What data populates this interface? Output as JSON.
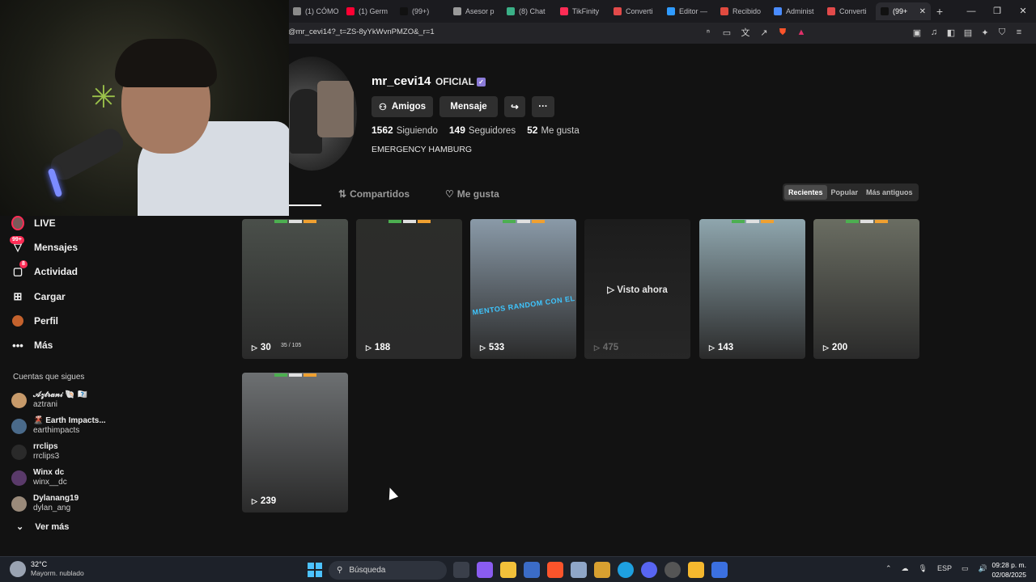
{
  "browser": {
    "tabs": [
      {
        "label": "(1) CÓMO",
        "color": "#8a8a8a"
      },
      {
        "label": "(1) Germ",
        "color": "#ff0033"
      },
      {
        "label": "(99+) ",
        "color": "#111111"
      },
      {
        "label": "Asesor p",
        "color": "#9a9a9a"
      },
      {
        "label": "(8) Chat",
        "color": "#3ab087"
      },
      {
        "label": "TikFinity",
        "color": "#fe2c55"
      },
      {
        "label": "Converti",
        "color": "#e24a4a"
      },
      {
        "label": "Editor —",
        "color": "#2f9bff"
      },
      {
        "label": "Recibido",
        "color": "#e04a3f"
      },
      {
        "label": "Administ",
        "color": "#4a8cff"
      },
      {
        "label": "Converti",
        "color": "#e24a4a"
      },
      {
        "label": "(99+",
        "color": "#111111"
      }
    ],
    "url": "@mr_cevi14?_t=ZS-8yYkWvnPMZO&_r=1"
  },
  "sidebar": {
    "items": [
      {
        "label": "LIVE",
        "icon": "live-avatar-icon"
      },
      {
        "label": "Mensajes",
        "icon": "messages-icon",
        "badge": "99+"
      },
      {
        "label": "Actividad",
        "icon": "activity-icon",
        "badge": "8"
      },
      {
        "label": "Cargar",
        "icon": "upload-icon"
      },
      {
        "label": "Perfil",
        "icon": "profile-icon"
      },
      {
        "label": "Más",
        "icon": "more-icon"
      }
    ],
    "following_title": "Cuentas que sigues",
    "following": [
      {
        "name": "𝒜𝓏𝓉𝓇𝒶𝓃𝒾 🐚 🇽🇽",
        "handle": "aztrani",
        "color": "#c79a6a"
      },
      {
        "name": "🌋 Earth Impacts...",
        "handle": "earthimpacts",
        "color": "#4a6a8a"
      },
      {
        "name": "rrclips",
        "handle": "rrclips3",
        "color": "#2a2a2a"
      },
      {
        "name": "Winx dc",
        "handle": "winx__dc",
        "color": "#5a3a6a"
      },
      {
        "name": "Dylanang19",
        "handle": "dylan_ang",
        "color": "#9a8a7a"
      }
    ],
    "ver_mas": "Ver más"
  },
  "profile": {
    "username": "mr_cevi14",
    "oficial": "OFICIAL",
    "buttons": {
      "amigos": "Amigos",
      "mensaje": "Mensaje"
    },
    "stats": [
      {
        "value": "1562",
        "label": "Siguiendo"
      },
      {
        "value": "149",
        "label": "Seguidores"
      },
      {
        "value": "52",
        "label": "Me gusta"
      }
    ],
    "bio": "EMERGENCY HAMBURG",
    "tabs": {
      "videos": "eos",
      "compartidos": "Compartidos",
      "me_gusta": "Me gusta"
    },
    "sort": [
      "Recientes",
      "Popular",
      "Más antiguos"
    ]
  },
  "videos": [
    {
      "views": "30",
      "bg": "#4a4f4a",
      "inner": "35 / 105"
    },
    {
      "views": "188",
      "bg": "#2c2d2a"
    },
    {
      "views": "533",
      "bg": "#8a9aa8",
      "overlay_text": "MENTOS RANDOM CON EL CEVI"
    },
    {
      "views": "475",
      "bg": "#1e1e1e",
      "watched": "Visto ahora"
    },
    {
      "views": "143",
      "bg": "#8fa6ae"
    },
    {
      "views": "200",
      "bg": "#6a6d62"
    },
    {
      "views": "239",
      "bg": "#6d7072"
    }
  ],
  "taskbar": {
    "temp": "32°C",
    "weather": "Mayorm. nublado",
    "search": "Búsqueda",
    "lang": "ESP",
    "time": "09:28 p. m.",
    "date": "02/08/2025"
  }
}
